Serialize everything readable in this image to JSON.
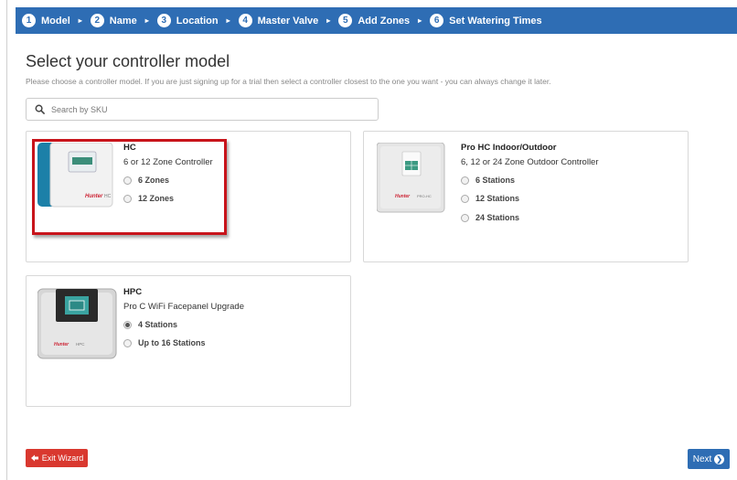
{
  "wizard": {
    "steps": [
      {
        "num": "1",
        "label": "Model"
      },
      {
        "num": "2",
        "label": "Name"
      },
      {
        "num": "3",
        "label": "Location"
      },
      {
        "num": "4",
        "label": "Master Valve"
      },
      {
        "num": "5",
        "label": "Add Zones"
      },
      {
        "num": "6",
        "label": "Set Watering Times"
      }
    ],
    "step_separator": "▸"
  },
  "page": {
    "title": "Select your controller model",
    "subtitle": "Please choose a controller model. If you are just signing up for a trial then select a controller closest to the one you want - you can always change it later."
  },
  "search": {
    "placeholder": "Search by SKU",
    "value": ""
  },
  "models": {
    "hc": {
      "name": "HC",
      "description": "6 or 12 Zone Controller",
      "options": [
        "6 Zones",
        "12 Zones"
      ],
      "selected_option": "",
      "highlighted": true
    },
    "prohc": {
      "name": "Pro HC Indoor/Outdoor",
      "description": "6, 12 or 24 Zone Outdoor Controller",
      "options": [
        "6 Stations",
        "12 Stations",
        "24 Stations"
      ],
      "selected_option": ""
    },
    "hpc": {
      "name": "HPC",
      "description": "Pro C WiFi Facepanel Upgrade",
      "options": [
        "4 Stations",
        "Up to 16 Stations"
      ],
      "selected_option": "4 Stations"
    }
  },
  "device_labels": {
    "hc_brand": "Hunter",
    "hc_model": "HC",
    "prohc_brand": "Hunter",
    "prohc_model": "PRO-HC",
    "hpc_brand": "Hunter",
    "hpc_model": "HPC"
  },
  "buttons": {
    "exit_label": "Exit Wizard",
    "next_label": "Next"
  },
  "colors": {
    "primary": "#2e6db4",
    "danger": "#d9382f",
    "highlight": "#c8141b"
  },
  "icons": {
    "search": "search-icon",
    "exit": "sign-out-icon",
    "next": "chevron-circle-right-icon"
  }
}
